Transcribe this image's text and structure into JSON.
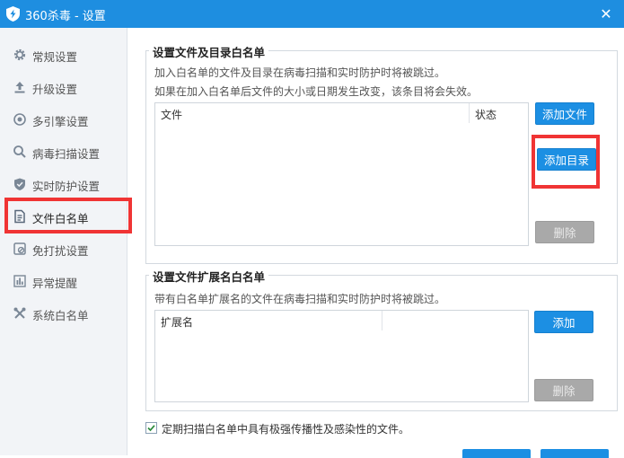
{
  "window": {
    "title": "360杀毒 - 设置",
    "close_glyph": "✕",
    "accent": "#1e8ee0"
  },
  "sidebar": {
    "items": [
      {
        "label": "常规设置",
        "icon": "gear-icon"
      },
      {
        "label": "升级设置",
        "icon": "upload-icon"
      },
      {
        "label": "多引擎设置",
        "icon": "engine-icon"
      },
      {
        "label": "病毒扫描设置",
        "icon": "search-icon"
      },
      {
        "label": "实时防护设置",
        "icon": "shield-icon"
      },
      {
        "label": "文件白名单",
        "icon": "document-icon",
        "active": true
      },
      {
        "label": "免打扰设置",
        "icon": "no-disturb-icon"
      },
      {
        "label": "异常提醒",
        "icon": "bar-chart-icon"
      },
      {
        "label": "系统白名单",
        "icon": "tools-icon"
      }
    ]
  },
  "file_whitelist": {
    "title": "设置文件及目录白名单",
    "desc1": "加入白名单的文件及目录在病毒扫描和实时防护时将被跳过。",
    "desc2": "如果在加入白名单后文件的大小或日期发生改变，该条目将会失效。",
    "columns": {
      "file": "文件",
      "status": "状态"
    },
    "add_file": "添加文件",
    "add_dir": "添加目录",
    "delete": "删除"
  },
  "ext_whitelist": {
    "title": "设置文件扩展名白名单",
    "desc": "带有白名单扩展名的文件在病毒扫描和实时防护时将被跳过。",
    "columns": {
      "ext": "扩展名"
    },
    "add": "添加",
    "delete": "删除"
  },
  "option": {
    "checked": true,
    "label": "定期扫描白名单中具有极强传播性及感染性的文件。"
  },
  "highlight_color": "#f03434"
}
